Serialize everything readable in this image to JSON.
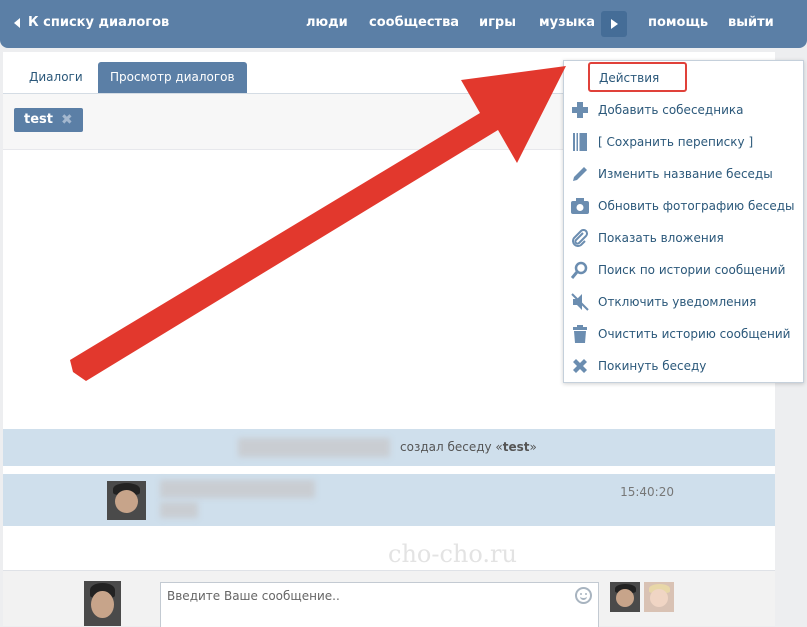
{
  "header": {
    "back_label": "К списку диалогов",
    "nav": [
      "люди",
      "сообщества",
      "игры",
      "музыка",
      "помощь",
      "выйти"
    ]
  },
  "tabs": {
    "dialogs": "Диалоги",
    "view": "Просмотр диалогов"
  },
  "filter_chip": {
    "label": "test",
    "remove_glyph": "✖"
  },
  "system_message": {
    "text_prefix": "создал беседу «",
    "chat_name": "test",
    "text_suffix": "»"
  },
  "message": {
    "time": "15:40:20"
  },
  "watermark": "cho-cho.ru",
  "composer": {
    "placeholder": "Введите Ваше сообщение.."
  },
  "menu": {
    "header": "Действия",
    "items": [
      {
        "label": "Добавить собеседника",
        "icon": "plus-icon"
      },
      {
        "label": "[ Сохранить переписку ]",
        "icon": "book-icon"
      },
      {
        "label": "Изменить название беседы",
        "icon": "pencil-icon"
      },
      {
        "label": "Обновить фотографию беседы",
        "icon": "camera-icon"
      },
      {
        "label": "Показать вложения",
        "icon": "paperclip-icon"
      },
      {
        "label": "Поиск по истории сообщений",
        "icon": "search-icon"
      },
      {
        "label": "Отключить уведомления",
        "icon": "mute-icon"
      },
      {
        "label": "Очистить историю сообщений",
        "icon": "trash-icon"
      },
      {
        "label": "Покинуть беседу",
        "icon": "close-icon"
      }
    ]
  },
  "colors": {
    "header_bg": "#5b7fa6",
    "link": "#2b587a",
    "highlight": "#e0413a",
    "arrow": "#e2382d",
    "icon": "#6b8db0"
  }
}
